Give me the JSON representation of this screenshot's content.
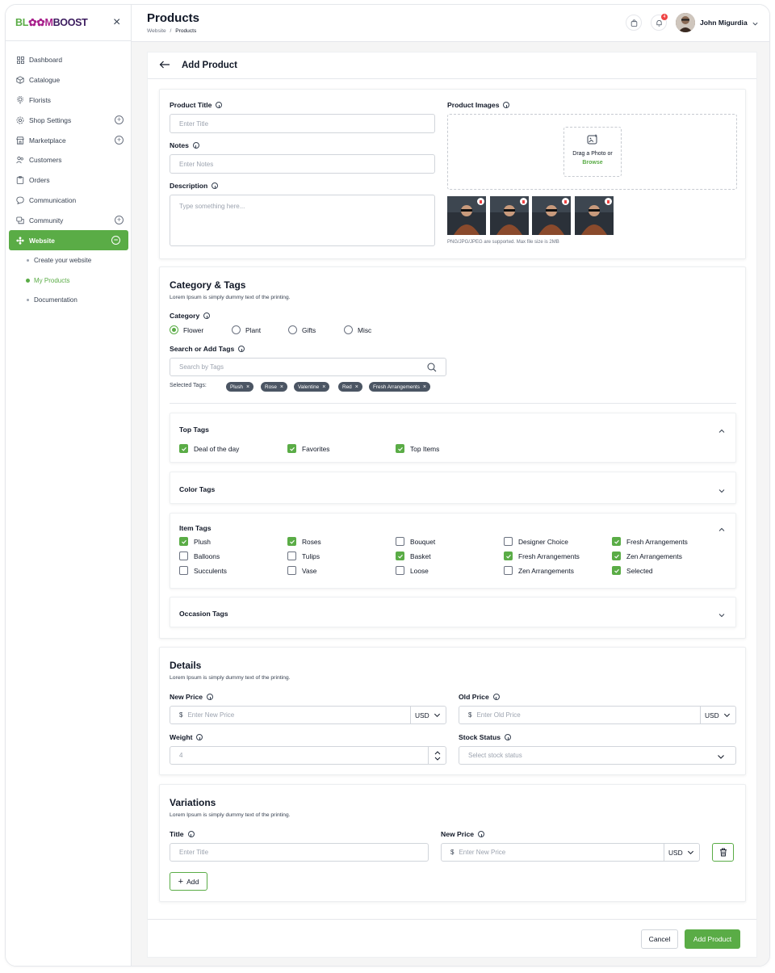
{
  "brand": {
    "logo_part1": "BL",
    "logo_part2": "✿✿",
    "logo_part3": "M",
    "logo_part4": "BOOST"
  },
  "sidebar": {
    "items": [
      {
        "label": "Dashboard",
        "icon": "dashboard-icon"
      },
      {
        "label": "Catalogue",
        "icon": "box-icon"
      },
      {
        "label": "Florists",
        "icon": "florist-icon"
      },
      {
        "label": "Shop Settings",
        "icon": "settings-icon"
      },
      {
        "label": "Marketplace",
        "icon": "store-icon"
      },
      {
        "label": "Customers",
        "icon": "users-icon"
      },
      {
        "label": "Orders",
        "icon": "clipboard-icon"
      },
      {
        "label": "Communication",
        "icon": "chat-icon"
      },
      {
        "label": "Community",
        "icon": "community-icon"
      },
      {
        "label": "Website",
        "icon": "website-icon"
      }
    ],
    "sub_items": [
      "Create your website",
      "My Products",
      "Documentation"
    ]
  },
  "header": {
    "title": "Products",
    "breadcrumb_root": "Website",
    "breadcrumb_sep": "/",
    "breadcrumb_current": "Products",
    "notification_count": "4",
    "user_name": "John Migurdia"
  },
  "panel": {
    "title": "Add Product"
  },
  "basic": {
    "product_title_label": "Product Title",
    "product_title_placeholder": "Enter Title",
    "notes_label": "Notes",
    "notes_placeholder": "Enter Notes",
    "description_label": "Description",
    "description_placeholder": "Type something here...",
    "images_label": "Product Images",
    "upload_text": "Drag a Photo or",
    "upload_link": "Browse",
    "upload_hint": "PNG/JPG/JPEG are supported. Max file size is 2MB"
  },
  "category": {
    "title": "Category & Tags",
    "subtitle": "Lorem Ipsum is simply dummy text of the printing.",
    "category_label": "Category",
    "options": [
      "Flower",
      "Plant",
      "Gifts",
      "Misc"
    ],
    "selected": "Flower",
    "tags_label": "Search or Add Tags",
    "tags_placeholder": "Search by Tags",
    "selected_tags_label": "Selected Tags:",
    "selected_tags": [
      "Plush",
      "Rose",
      "Valentine",
      "Red",
      "Fresh Arrangements"
    ]
  },
  "top_tags": {
    "title": "Top Tags",
    "items": [
      {
        "label": "Deal of the day",
        "checked": true
      },
      {
        "label": "Favorites",
        "checked": true
      },
      {
        "label": "Top Items",
        "checked": true
      }
    ]
  },
  "color_tags": {
    "title": "Color Tags"
  },
  "item_tags": {
    "title": "Item Tags",
    "items": [
      {
        "label": "Plush",
        "checked": true
      },
      {
        "label": "Roses",
        "checked": true
      },
      {
        "label": "Bouquet",
        "checked": false
      },
      {
        "label": "Designer Choice",
        "checked": false
      },
      {
        "label": "Fresh Arrangements",
        "checked": true
      },
      {
        "label": "Balloons",
        "checked": false
      },
      {
        "label": "Tulips",
        "checked": false
      },
      {
        "label": "Basket",
        "checked": true
      },
      {
        "label": "Fresh Arrangements",
        "checked": true
      },
      {
        "label": "Zen Arrangements",
        "checked": true
      },
      {
        "label": "Succulents",
        "checked": false
      },
      {
        "label": "Vase",
        "checked": false
      },
      {
        "label": "Loose",
        "checked": false
      },
      {
        "label": "Zen Arrangements",
        "checked": false
      },
      {
        "label": "Selected",
        "checked": true
      }
    ]
  },
  "occasion_tags": {
    "title": "Occasion Tags"
  },
  "details": {
    "title": "Details",
    "subtitle": "Lorem Ipsum is simply dummy text of the printing.",
    "new_price_label": "New Price",
    "new_price_placeholder": "Enter New Price",
    "old_price_label": "Old Price",
    "old_price_placeholder": "Enter Old Price",
    "currency_symbol": "$",
    "currency": "USD",
    "weight_label": "Weight",
    "weight_value": "4",
    "stock_label": "Stock Status",
    "stock_placeholder": "Select stock status"
  },
  "variations": {
    "title": "Variations",
    "subtitle": "Lorem Ipsum is simply dummy text of the printing.",
    "title_label": "Title",
    "title_placeholder": "Enter Title",
    "price_label": "New Price",
    "price_placeholder": "Enter New Price",
    "currency_symbol": "$",
    "currency": "USD",
    "add_label": "Add"
  },
  "footer": {
    "cancel_label": "Cancel",
    "submit_label": "Add Product"
  },
  "colors": {
    "accent": "#5aac46",
    "brand_purple": "#a8208c",
    "chip": "#4b5563"
  }
}
